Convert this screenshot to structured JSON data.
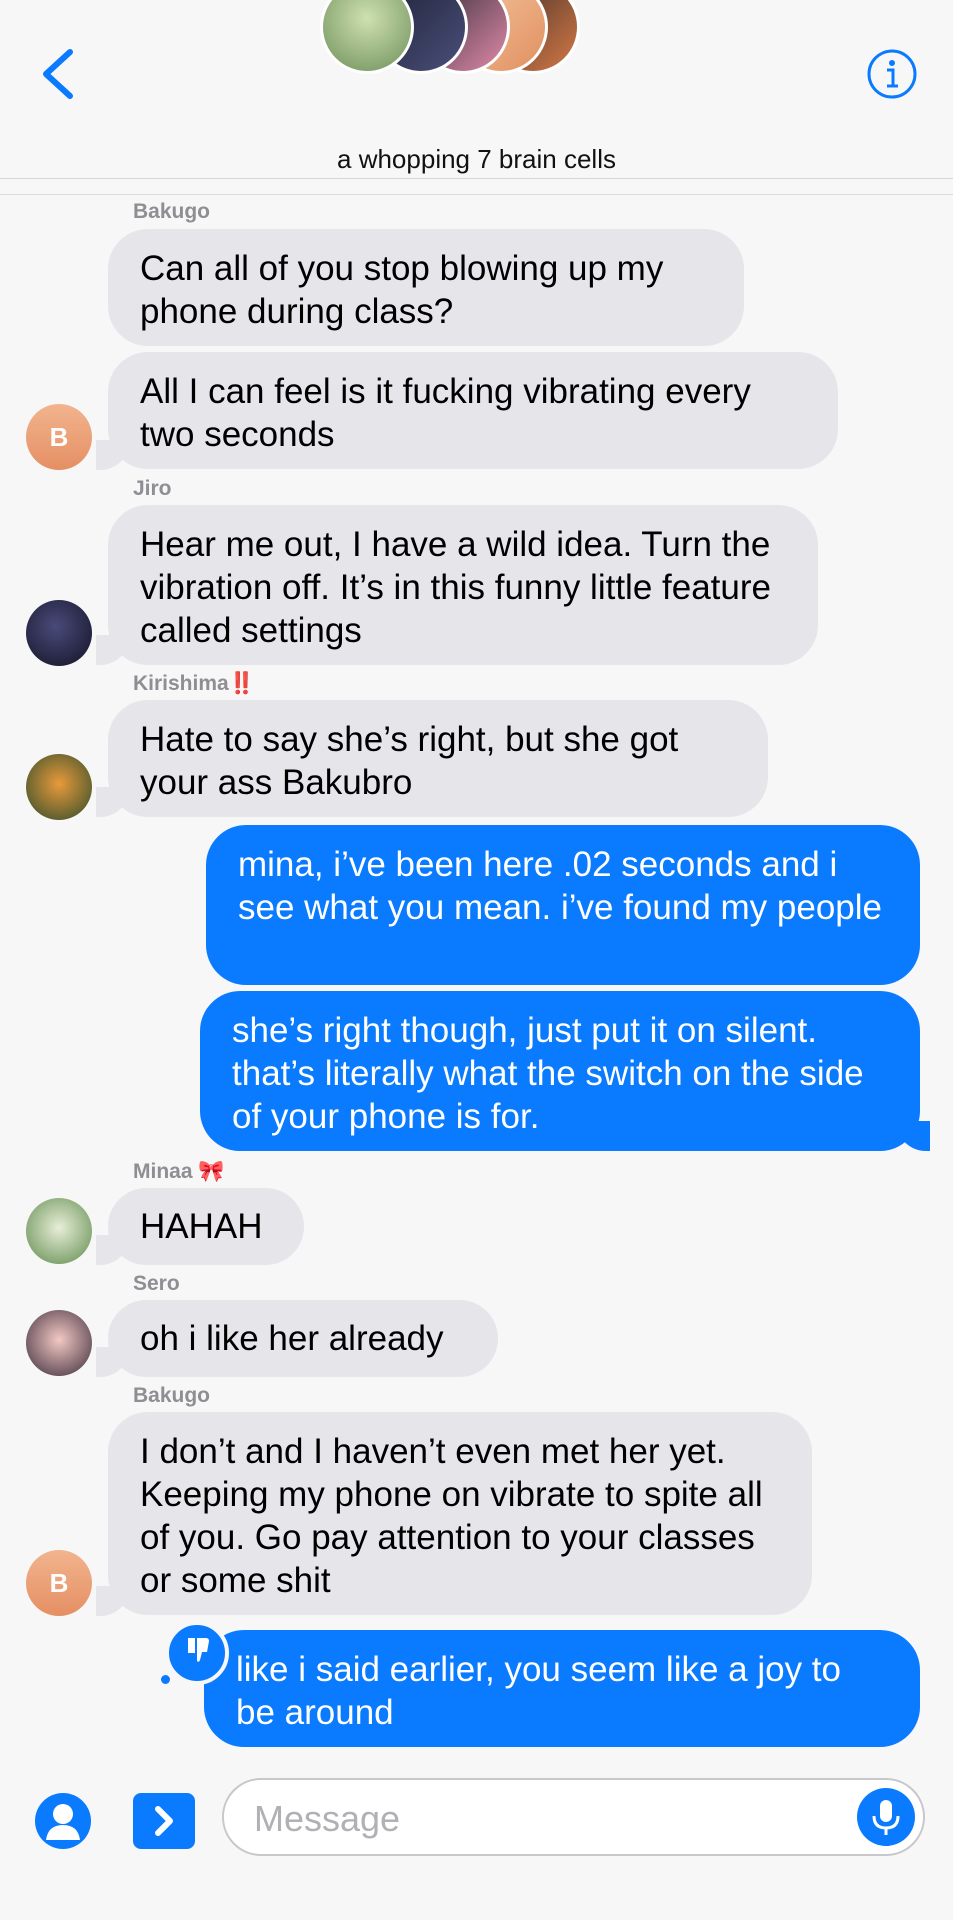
{
  "header": {
    "back_icon": "chevron-left-icon",
    "info_icon": "info-circle-icon",
    "title": "a whopping 7 brain cells",
    "accent": "#0a7bff"
  },
  "messages": [
    {
      "sender": "Bakugo",
      "text": "Can all of you stop blowing up my phone during class?"
    },
    {
      "text": "All I can feel is it fucking vibrating every two seconds",
      "avatar": "B"
    },
    {
      "sender": "Jiro",
      "text": "Hear me out, I have a wild idea. Turn the vibration off. It’s in this funny little feature called settings"
    },
    {
      "sender": "Kirishima",
      "sender_emoji": "‼️",
      "text": "Hate to say she’s right, but she got your ass Bakubro"
    },
    {
      "text": "mina, i’ve been here .02 seconds and i see what you mean. i’ve found my people"
    },
    {
      "text": "she’s right though, just put it on silent. that’s literally what the switch on the side of your phone is for."
    },
    {
      "sender": "Minaa",
      "sender_emoji": "🎀",
      "text": "HAHAH"
    },
    {
      "sender": "Sero",
      "text": "oh i like her already"
    },
    {
      "sender": "Bakugo",
      "text": "I don’t and I haven’t even met her yet. Keeping my phone on vibrate to spite all of you. Go pay attention to your classes or some shit",
      "avatar": "B"
    },
    {
      "text": "like i said earlier, you seem like a joy to be around",
      "reaction": "thumbs-down-icon"
    }
  ],
  "composer": {
    "placeholder": "Message",
    "contact_icon": "person-icon",
    "apps_icon": "chevron-right-icon",
    "mic_icon": "mic-icon"
  }
}
